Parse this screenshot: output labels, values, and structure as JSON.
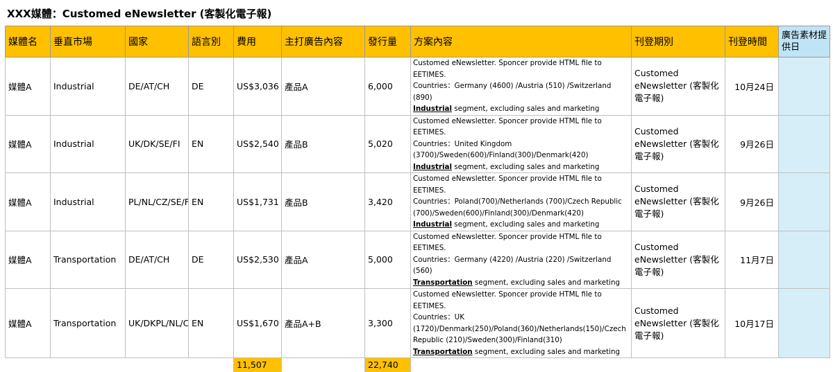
{
  "title": "XXX媒體：Customed eNewsletter (客製化電子報)",
  "headers": [
    "媒體名",
    "垂直市場",
    "國家",
    "語言別",
    "費用",
    "主打廣告內容",
    "發行量",
    "方案內容",
    "刊登期別",
    "刊登時間",
    "廣告素材提供日"
  ],
  "rows": [
    {
      "media": "媒體A",
      "market": "Industrial",
      "countries": "DE/AT/CH",
      "lang": "DE",
      "cost": "US$3,036",
      "ad": "產品A",
      "circulation": "6,000",
      "plan_line1": "Customed eNewsletter. Sponcer provide HTML file to EETIMES.",
      "plan_line2": "Countries：Germany (4600) /Austria (510) /Switzerland (890)",
      "plan_seg": "Industrial",
      "plan_seg_rest": " segment, excluding sales and marketing",
      "period": "Customed eNewsletter (客製化電子報)",
      "date": "10月24日",
      "material": ""
    },
    {
      "media": "媒體A",
      "market": "Industrial",
      "countries": "UK/DK/SE/FI",
      "lang": "EN",
      "cost": "US$2,540",
      "ad": "產品B",
      "circulation": "5,020",
      "plan_line1": "Customed eNewsletter. Sponcer provide HTML file to EETIMES.",
      "plan_line2": "Countries：United Kingdom (3700)/Sweden(600)/Finland(300)/Denmark(420)",
      "plan_seg": "Industrial",
      "plan_seg_rest": " segment, excluding sales and marketing",
      "period": "Customed eNewsletter (客製化電子報)",
      "date": "9月26日",
      "material": ""
    },
    {
      "media": "媒體A",
      "market": "Industrial",
      "countries": "PL/NL/CZ/SE/FI",
      "lang": "EN",
      "cost": "US$1,731",
      "ad": "產品B",
      "circulation": "3,420",
      "plan_line1": "Customed eNewsletter. Sponcer provide HTML file to EETIMES.",
      "plan_line2": "Countries：Poland(700)/Netherlands (700)/Czech Republic (700)/Sweden(600)/Finland(300)/Denmark(420)",
      "plan_seg": "Industrial",
      "plan_seg_rest": " segment, excluding sales and marketing",
      "period": "Customed eNewsletter (客製化電子報)",
      "date": "9月26日",
      "material": ""
    },
    {
      "media": "媒體A",
      "market": "Transportation",
      "countries": "DE/AT/CH",
      "lang": "DE",
      "cost": "US$2,530",
      "ad": "產品A",
      "circulation": "5,000",
      "plan_line1": "Customed eNewsletter. Sponcer provide HTML file to EETIMES.",
      "plan_line2": "Countries：Germany (4220) /Austria (220) /Switzerland (560)",
      "plan_seg": "Transportation",
      "plan_seg_rest": " segment, excluding sales and marketing",
      "period": "Customed eNewsletter (客製化電子報)",
      "date": "11月7日",
      "material": ""
    },
    {
      "media": "媒體A",
      "market": "Transportation",
      "countries": "UK/DKPL/NL/CZ/SE/FI",
      "lang": "EN",
      "cost": "US$1,670",
      "ad": "產品A+B",
      "circulation": "3,300",
      "plan_line1": "Customed eNewsletter. Sponcer provide HTML file to EETIMES.",
      "plan_line2": "Countries：UK (1720)/Denmark(250)/Poland(360)/Netherlands(150)/Czech Republic (210)/Sweden(300)/Finland(310)",
      "plan_seg": "Transportation",
      "plan_seg_rest": " segment, excluding sales and marketing",
      "period": "Customed eNewsletter (客製化電子報)",
      "date": "10月17日",
      "material": ""
    }
  ],
  "totals": {
    "cost": "11,507",
    "circulation": "22,740"
  },
  "colors": {
    "header": "#ffc000",
    "material_header": "#bfe4f5",
    "material_cell": "#d6eef8",
    "grid": "#bfbfbf"
  }
}
